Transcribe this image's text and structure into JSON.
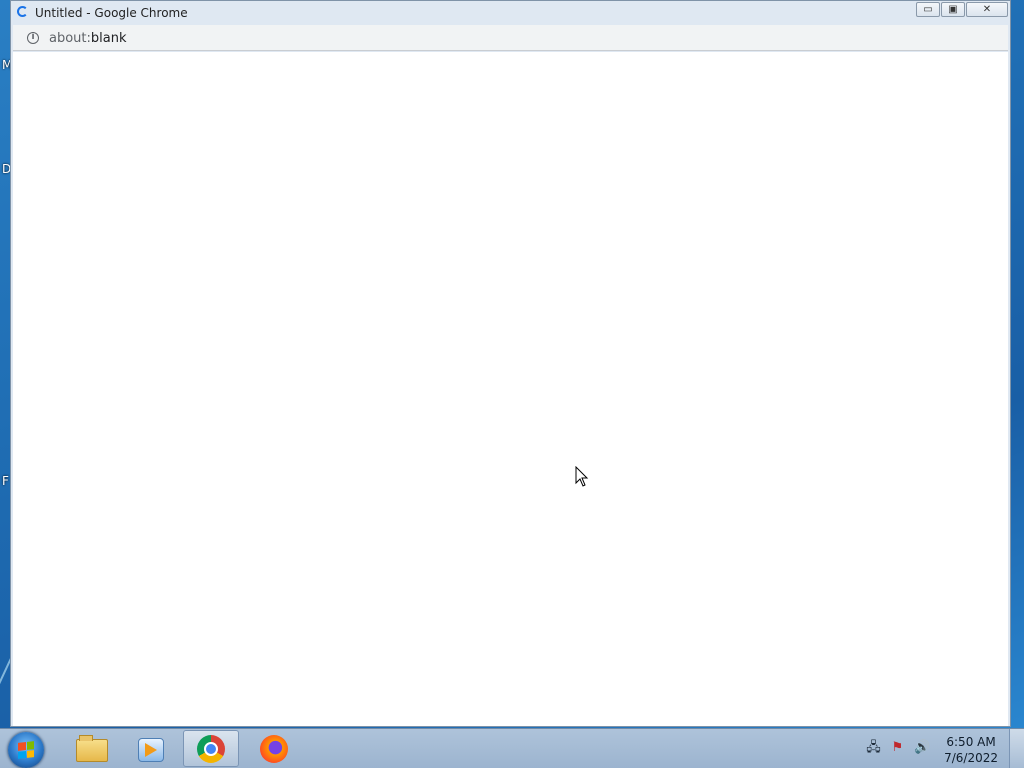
{
  "window": {
    "title": "Untitled - Google Chrome",
    "buttons": {
      "minimize": "▭",
      "maximize": "▣",
      "close": "✕"
    }
  },
  "addressbar": {
    "scheme": "about:",
    "path": "blank",
    "icon": "info-icon"
  },
  "desktop": {
    "edge_letters": [
      "M",
      "D",
      "F"
    ]
  },
  "taskbar": {
    "items": [
      {
        "name": "start-button",
        "icon": "windows-logo-icon"
      },
      {
        "name": "file-explorer",
        "icon": "folder-icon"
      },
      {
        "name": "media-player",
        "icon": "media-player-icon"
      },
      {
        "name": "google-chrome",
        "icon": "chrome-icon",
        "active": true
      },
      {
        "name": "firefox",
        "icon": "firefox-icon"
      }
    ],
    "tray": {
      "icons": [
        "network-icon",
        "action-center-flag-icon",
        "volume-icon"
      ],
      "time": "6:50 AM",
      "date": "7/6/2022"
    }
  },
  "colors": {
    "desktop": "#1f6db3",
    "taskbar": "#9cb4cf",
    "titlebar": "#dfe8f2",
    "accent": "#1a73e8"
  }
}
